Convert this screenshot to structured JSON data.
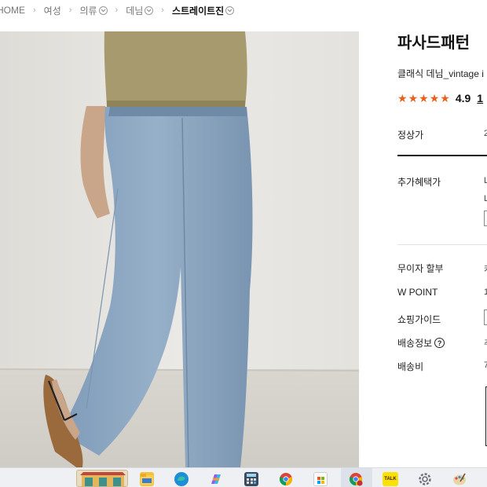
{
  "breadcrumb": {
    "items": [
      {
        "label": "HOME"
      },
      {
        "label": "여성"
      },
      {
        "label": "의류"
      },
      {
        "label": "데님"
      },
      {
        "label": "스트레이트진"
      }
    ]
  },
  "product": {
    "brand": "파사드패턴",
    "subtitle": "클래식 데님_vintage i",
    "rating": {
      "stars": 5,
      "score": "4.9",
      "reviews": "1"
    }
  },
  "info_rows": {
    "regular_price": {
      "label": "정상가",
      "value": "2"
    },
    "extra_benefit": {
      "label": "추가혜택가",
      "value": "L"
    },
    "installment": {
      "label": "무이자 할부",
      "value": "카"
    },
    "w_point": {
      "label": "W POINT",
      "value": "1"
    },
    "shopping_guide": {
      "label": "쇼핑가이드"
    },
    "shipping_info": {
      "label": "배송정보",
      "value": "주"
    },
    "shipping_fee": {
      "label": "배송비",
      "value": "7"
    }
  },
  "colors": {
    "star": "#e8601c",
    "accent_dark": "#111111"
  },
  "taskbar": {
    "icons": [
      "beach-resort-icon",
      "file-explorer-icon",
      "edge-browser-icon",
      "copilot-icon",
      "calculator-icon",
      "chrome-icon",
      "microsoft-store-icon",
      "chrome-profile-icon",
      "kakaotalk-icon",
      "settings-icon",
      "paint-icon"
    ],
    "kakaotalk_label": "TALK"
  }
}
